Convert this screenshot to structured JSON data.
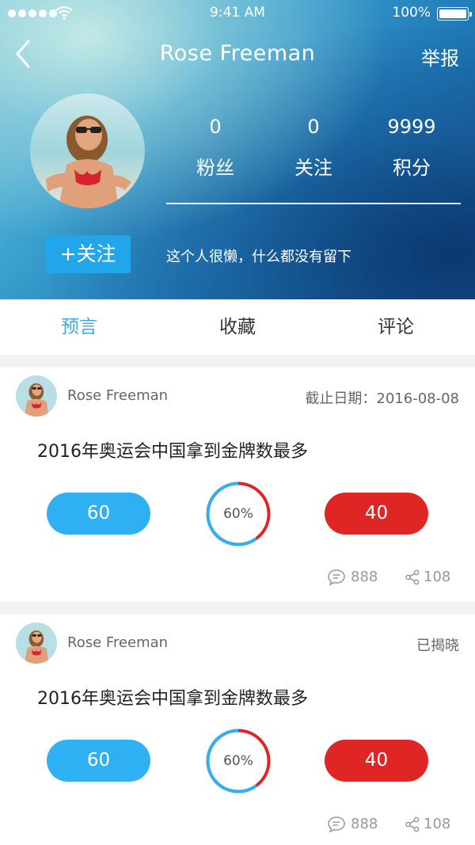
{
  "status_bar": {
    "time": "9:41 AM",
    "battery": "100%"
  },
  "nav": {
    "title": "Rose Freeman",
    "report_label": "举报"
  },
  "profile": {
    "stats": [
      {
        "value": "0",
        "label": "粉丝"
      },
      {
        "value": "0",
        "label": "关注"
      },
      {
        "value": "9999",
        "label": "积分"
      }
    ],
    "follow_label": "+关注",
    "bio": "这个人很懒，什么都没有留下"
  },
  "tabs": [
    {
      "label": "预言",
      "active": true
    },
    {
      "label": "收藏",
      "active": false
    },
    {
      "label": "评论",
      "active": false
    }
  ],
  "cards": [
    {
      "author": "Rose Freeman",
      "meta": "截止日期：2016-08-08",
      "question": "2016年奥运会中国拿到金牌数最多",
      "yes_value": "60",
      "no_value": "40",
      "percent_label": "60%",
      "percent": 0.6,
      "comments": "888",
      "shares": "108"
    },
    {
      "author": "Rose Freeman",
      "meta": "已揭晓",
      "question": "2016年奥运会中国拿到金牌数最多",
      "yes_value": "60",
      "no_value": "40",
      "percent_label": "60%",
      "percent": 0.6,
      "comments": "888",
      "shares": "108"
    }
  ],
  "colors": {
    "accent_blue": "#2fb0f2",
    "accent_red": "#e02525",
    "tab_active": "#3aa9e0"
  }
}
